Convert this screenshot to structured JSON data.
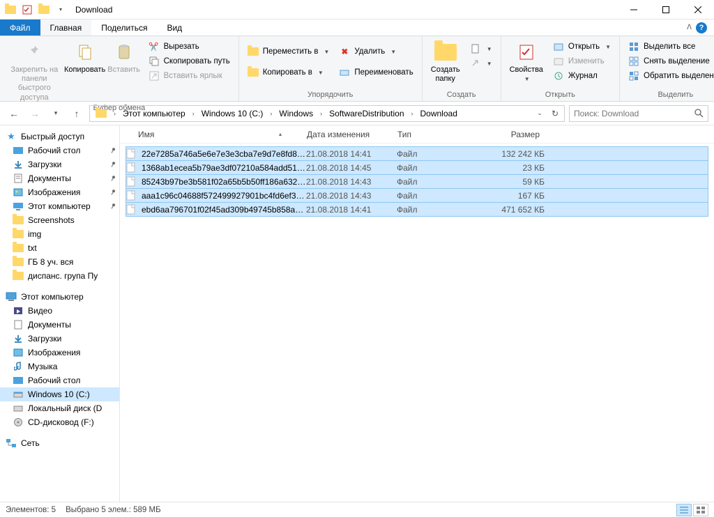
{
  "window": {
    "title": "Download"
  },
  "tabs": {
    "file": "Файл",
    "home": "Главная",
    "share": "Поделиться",
    "view": "Вид"
  },
  "ribbon": {
    "clipboard": {
      "label": "Буфер обмена",
      "pin": "Закрепить на панели\nбыстрого доступа",
      "copy": "Копировать",
      "paste": "Вставить",
      "cut": "Вырезать",
      "copypath": "Скопировать путь",
      "pastelink": "Вставить ярлык"
    },
    "organize": {
      "label": "Упорядочить",
      "moveto": "Переместить в",
      "copyto": "Копировать в",
      "delete": "Удалить",
      "rename": "Переименовать"
    },
    "new": {
      "label": "Создать",
      "newfolder": "Создать\nпапку"
    },
    "open": {
      "label": "Открыть",
      "properties": "Свойства",
      "open": "Открыть",
      "edit": "Изменить",
      "history": "Журнал"
    },
    "select": {
      "label": "Выделить",
      "all": "Выделить все",
      "none": "Снять выделение",
      "invert": "Обратить выделение"
    }
  },
  "address": {
    "crumbs": [
      "Этот компьютер",
      "Windows 10 (C:)",
      "Windows",
      "SoftwareDistribution",
      "Download"
    ],
    "search_placeholder": "Поиск: Download"
  },
  "columns": {
    "name": "Имя",
    "date": "Дата изменения",
    "type": "Тип",
    "size": "Размер"
  },
  "nav": {
    "quick": {
      "label": "Быстрый доступ",
      "items": [
        "Рабочий стол",
        "Загрузки",
        "Документы",
        "Изображения",
        "Этот компьютер",
        "Screenshots",
        "img",
        "txt",
        "ГБ 8 уч. вся",
        "диспанс. група Пу"
      ]
    },
    "pc": {
      "label": "Этот компьютер",
      "items": [
        "Видео",
        "Документы",
        "Загрузки",
        "Изображения",
        "Музыка",
        "Рабочий стол",
        "Windows 10 (C:)",
        "Локальный диск (D",
        "CD-дисковод (F:)"
      ]
    },
    "network": {
      "label": "Сеть"
    }
  },
  "files": [
    {
      "name": "22e7285a746a5e6e7e3e3cba7e9d7e8fd8e8...",
      "date": "21.08.2018 14:41",
      "type": "Файл",
      "size": "132 242 КБ"
    },
    {
      "name": "1368ab1ecea5b79ae3df07210a584add51d...",
      "date": "21.08.2018 14:45",
      "type": "Файл",
      "size": "23 КБ"
    },
    {
      "name": "85243b97be3b581f02a65b5b50ff186a632c...",
      "date": "21.08.2018 14:43",
      "type": "Файл",
      "size": "59 КБ"
    },
    {
      "name": "aaa1c96c04688f572499927901bc4fd6ef3a...",
      "date": "21.08.2018 14:43",
      "type": "Файл",
      "size": "167 КБ"
    },
    {
      "name": "ebd6aa796701f02f45ad309b49745b858a1a...",
      "date": "21.08.2018 14:41",
      "type": "Файл",
      "size": "471 652 КБ"
    }
  ],
  "status": {
    "count": "Элементов: 5",
    "selected": "Выбрано 5 элем.: 589 МБ"
  }
}
